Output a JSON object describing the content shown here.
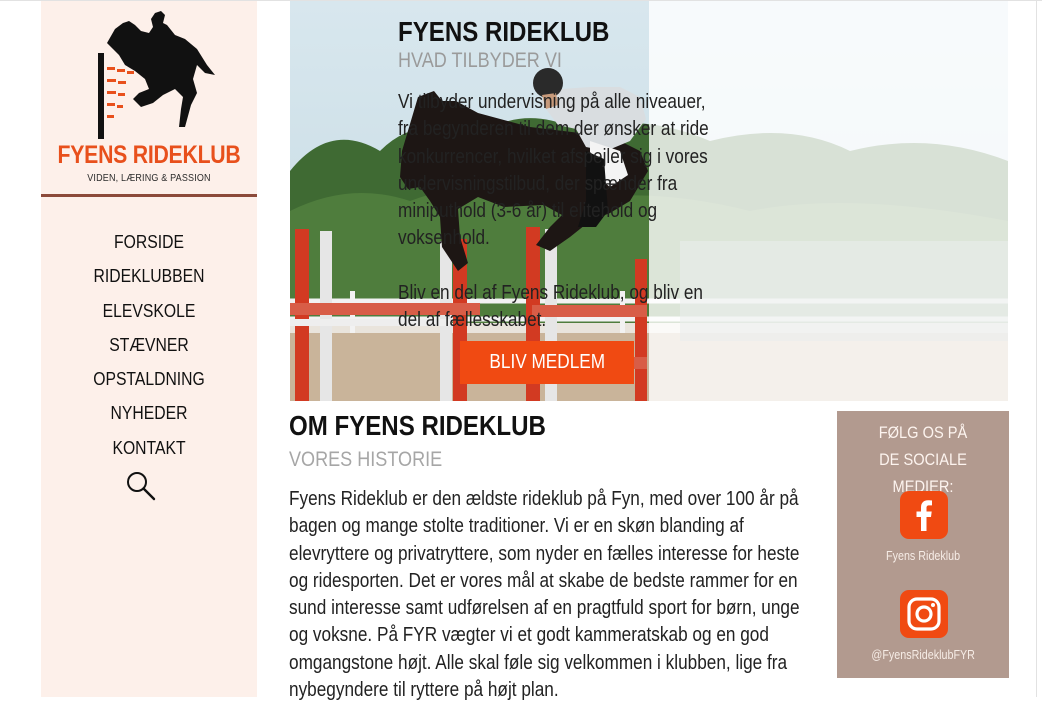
{
  "brand": {
    "name": "FYENS RIDEKLUB",
    "tagline": "VIDEN, LÆRING & PASSION"
  },
  "nav": {
    "items": [
      "FORSIDE",
      "RIDEKLUBBEN",
      "ELEVSKOLE",
      "STÆVNER",
      "OPSTALDNING",
      "NYHEDER",
      "KONTAKT"
    ],
    "search_icon": "search-icon"
  },
  "hero": {
    "title": "FYENS RIDEKLUB",
    "subtitle": "HVAD TILBYDER VI",
    "body1": "Vi tilbyder undervisning på alle niveauer, fra begynderen til dem der ønsker at ride konkurrencer, hvilket afspejler sig i vores undervisningstilbud, der spænder fra miniputhold (3-6 år) til elitehold og voksenhold.",
    "body2": "Bliv en del af Fyens Rideklub, og bliv en del af fællesskabet.",
    "button_label": "BLIV MEDLEM"
  },
  "about": {
    "title": "OM FYENS RIDEKLUB",
    "subtitle": "VORES HISTORIE",
    "body": "Fyens Rideklub er den ældste rideklub på Fyn, med over 100 år på bagen og mange stolte traditioner. Vi er en skøn blanding af elevryttere og privatryttere, som nyder en fælles interesse for heste og ridesporten. Det er vores mål at skabe de bedste rammer for en sund interesse samt udførelsen af en pragtfuld sport for børn, unge og voksne. På FYR vægter vi et godt kammeratskab og en god omgangstone højt. Alle skal føle sig velkommen i klubben, lige fra nybegyndere til ryttere på højt plan."
  },
  "social": {
    "heading_line1": "FØLG OS PÅ",
    "heading_line2": "DE SOCIALE MEDIER:",
    "facebook": {
      "icon": "facebook-icon",
      "caption": "Fyens Rideklub"
    },
    "instagram": {
      "icon": "instagram-icon",
      "caption": "@FyensRideklubFYR"
    }
  },
  "colors": {
    "accent": "#f04a12",
    "brand_orange": "#e8501c",
    "sidebar_bg": "#fdf0ea",
    "divider": "#8c4a3a",
    "social_bg": "#b29a8f"
  }
}
